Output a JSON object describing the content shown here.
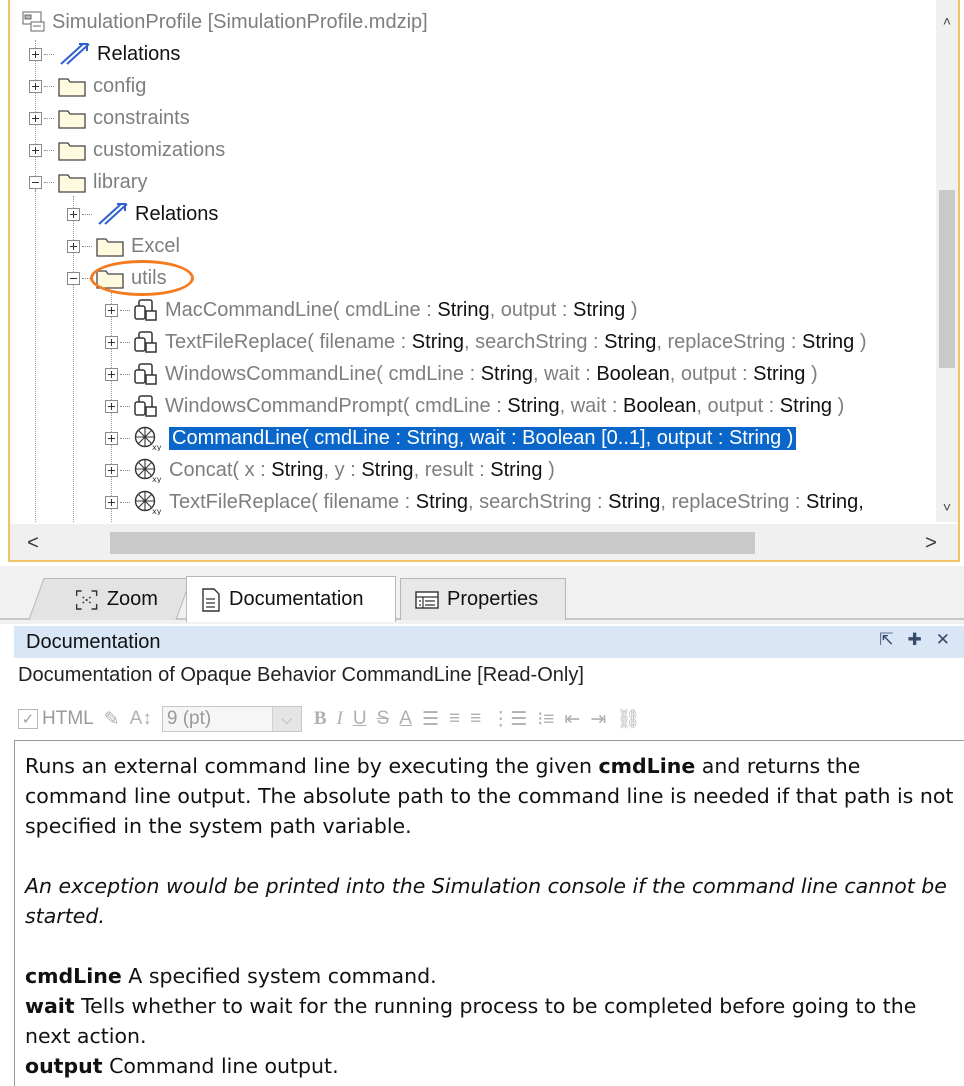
{
  "tree": {
    "root": "SimulationProfile [SimulationProfile.mdzip]",
    "items": [
      {
        "label": "Relations"
      },
      {
        "label": "config"
      },
      {
        "label": "constraints"
      },
      {
        "label": "customizations"
      },
      {
        "label": "library"
      },
      {
        "label": "Relations"
      },
      {
        "label": "Excel"
      },
      {
        "label": "utils"
      }
    ],
    "behaviors": [
      {
        "name": "MacCommandLine(",
        "p1": "cmdLine",
        "t1": "String",
        "p2": "output",
        "t2": "String",
        "close": ")"
      },
      {
        "name": "TextFileReplace(",
        "p1": "filename",
        "t1": "String",
        "p2": "searchString",
        "t2": "String",
        "p3": "replaceString",
        "t3": "String",
        "close": ")"
      },
      {
        "name": "WindowsCommandLine(",
        "p1": "cmdLine",
        "t1": "String",
        "p2": "wait",
        "t2": "Boolean",
        "p3": "output",
        "t3": "String",
        "close": ")"
      },
      {
        "name": "WindowsCommandPrompt(",
        "p1": "cmdLine",
        "t1": "String",
        "p2": "wait",
        "t2": "Boolean",
        "p3": "output",
        "t3": "String",
        "close": ")"
      },
      {
        "selected_text": "CommandLine( cmdLine : String, wait : Boolean [0..1], output : String )"
      },
      {
        "name": "Concat(",
        "p1": "x",
        "t1": "String",
        "p2": "y",
        "t2": "String",
        "p3": "result",
        "t3": "String",
        "close": ")"
      },
      {
        "name": "TextFileReplace(",
        "p1": "filename",
        "t1": "String",
        "p2": "searchString",
        "t2": "String",
        "p3": "replaceString",
        "t3": "String,",
        "close": ""
      }
    ],
    "scroll_up": "˄",
    "scroll_down": "˅",
    "scroll_left": "<",
    "scroll_right": ">"
  },
  "tabs": {
    "zoom": "Zoom",
    "documentation": "Documentation",
    "properties": "Properties"
  },
  "doc_panel": {
    "header": "Documentation",
    "subtitle": "Documentation of Opaque Behavior CommandLine [Read-Only]",
    "toolbar": {
      "html_label": "HTML",
      "font_size": "9 (pt)"
    },
    "body": {
      "p1_pre": "Runs an external command line by executing the given ",
      "p1_bold": "cmdLine",
      "p1_post": " and returns the command line output. The absolute path to the command line is needed if that path is not specified in the system path variable.",
      "p2": "An exception would be printed into the Simulation console if the command line cannot be started.",
      "param1_name": "cmdLine",
      "param1_desc": " A specified system command.",
      "param2_name": "wait",
      "param2_desc": " Tells whether to wait for the running process to be completed before going to the next action.",
      "param3_name": "output",
      "param3_desc": " Command line output."
    }
  },
  "colors": {
    "selection": "#0a66c8",
    "highlight_ring": "#f47b20",
    "panel_border": "#f0c468",
    "doc_header_bg": "#d8e6f6"
  }
}
